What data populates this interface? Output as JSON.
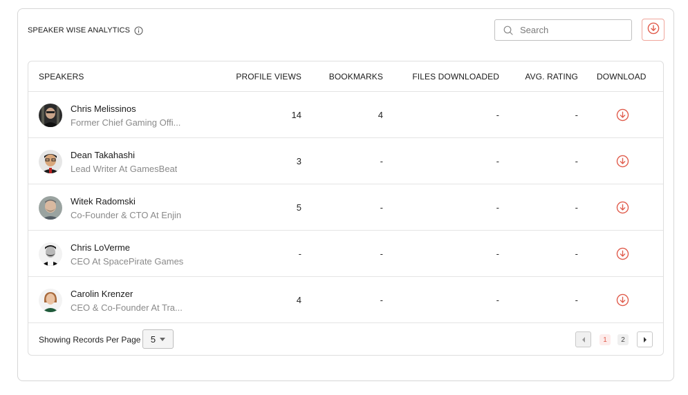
{
  "header": {
    "title": "SPEAKER WISE ANALYTICS",
    "info_icon": "info-circle-icon",
    "search_placeholder": "Search",
    "search_value": "",
    "export_icon": "download-circle-icon"
  },
  "table": {
    "columns": [
      "SPEAKERS",
      "PROFILE VIEWS",
      "BOOKMARKS",
      "FILES DOWNLOADED",
      "AVG. RATING",
      "DOWNLOAD"
    ],
    "rows": [
      {
        "name": "Chris Melissinos",
        "subtitle": "Former Chief Gaming Offi...",
        "profile_views": "14",
        "bookmarks": "4",
        "files_downloaded": "-",
        "avg_rating": "-"
      },
      {
        "name": "Dean Takahashi",
        "subtitle": "Lead Writer At GamesBeat",
        "profile_views": "3",
        "bookmarks": "-",
        "files_downloaded": "-",
        "avg_rating": "-"
      },
      {
        "name": "Witek Radomski",
        "subtitle": "Co-Founder & CTO At Enjin",
        "profile_views": "5",
        "bookmarks": "-",
        "files_downloaded": "-",
        "avg_rating": "-"
      },
      {
        "name": "Chris LoVerme",
        "subtitle": "CEO At SpacePirate Games",
        "profile_views": "-",
        "bookmarks": "-",
        "files_downloaded": "-",
        "avg_rating": "-"
      },
      {
        "name": "Carolin Krenzer",
        "subtitle": "CEO & Co-Founder At Tra...",
        "profile_views": "4",
        "bookmarks": "-",
        "files_downloaded": "-",
        "avg_rating": "-"
      }
    ]
  },
  "footer": {
    "records_label": "Showing Records Per Page",
    "per_page": "5",
    "pages": [
      "1",
      "2"
    ],
    "current_page": "1"
  },
  "colors": {
    "accent": "#e05a4a",
    "border": "#d6d6d6",
    "muted_text": "#8a8a8a"
  }
}
